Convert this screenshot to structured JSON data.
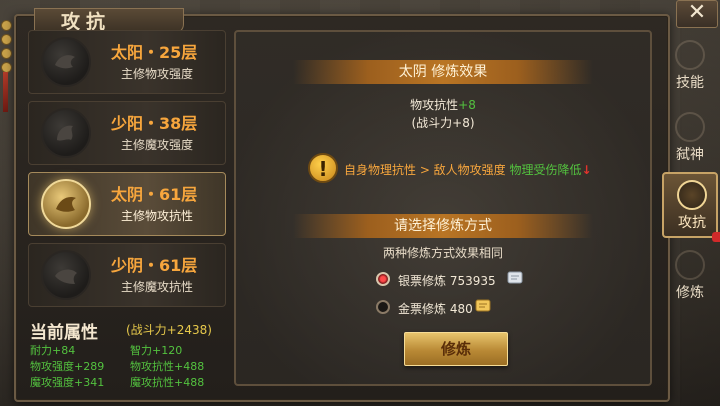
{
  "window": {
    "title": "攻抗",
    "close_label": "✕"
  },
  "stages": [
    {
      "name": "太阳・25层",
      "desc": "主修物攻强度",
      "icon": "dragon-emblem-icon",
      "selected": false
    },
    {
      "name": "少阳・38层",
      "desc": "主修魔攻强度",
      "icon": "phoenix-emblem-icon",
      "selected": false
    },
    {
      "name": "太阴・61层",
      "desc": "主修物攻抗性",
      "icon": "crane-emblem-icon",
      "selected": true
    },
    {
      "name": "少阴・61层",
      "desc": "主修魔攻抗性",
      "icon": "tiger-emblem-icon",
      "selected": false
    }
  ],
  "current_attrs": {
    "heading": "当前属性",
    "power": "(战斗力+2438)",
    "items": [
      {
        "label": "耐力",
        "value": "+84"
      },
      {
        "label": "智力",
        "value": "+120"
      },
      {
        "label": "物攻强度",
        "value": "+289"
      },
      {
        "label": "物攻抗性",
        "value": "+488"
      },
      {
        "label": "魔攻强度",
        "value": "+341"
      },
      {
        "label": "魔攻抗性",
        "value": "+488"
      }
    ]
  },
  "effect": {
    "title": "太阴 修炼效果",
    "stat_label": "物攻抗性",
    "stat_value": "+8",
    "power": "(战斗力+8)",
    "note_prefix": "自身物理抗性 > 敌人物攻强度",
    "note_suffix": "物理受伤降低",
    "note_arrow": "↓"
  },
  "method": {
    "title": "请选择修炼方式",
    "subtitle": "两种修炼方式效果相同",
    "options": [
      {
        "label": "银票修炼",
        "value": "753935",
        "icon": "silver-ticket-icon",
        "selected": true
      },
      {
        "label": "金票修炼",
        "value": "480",
        "icon": "gold-ticket-icon",
        "selected": false
      }
    ],
    "button_label": "修炼"
  },
  "tabs": [
    {
      "label": "技能",
      "icon": "skill-icon",
      "active": false
    },
    {
      "label": "弑神",
      "icon": "godslayer-icon",
      "active": false
    },
    {
      "label": "攻抗",
      "icon": "attack-resist-icon",
      "active": true
    },
    {
      "label": "修炼",
      "icon": "cultivate-icon",
      "active": false
    }
  ],
  "colors": {
    "accent": "#f7a63d",
    "green": "#53c23f",
    "gold": "#e7c94b",
    "red": "#e0332d"
  }
}
